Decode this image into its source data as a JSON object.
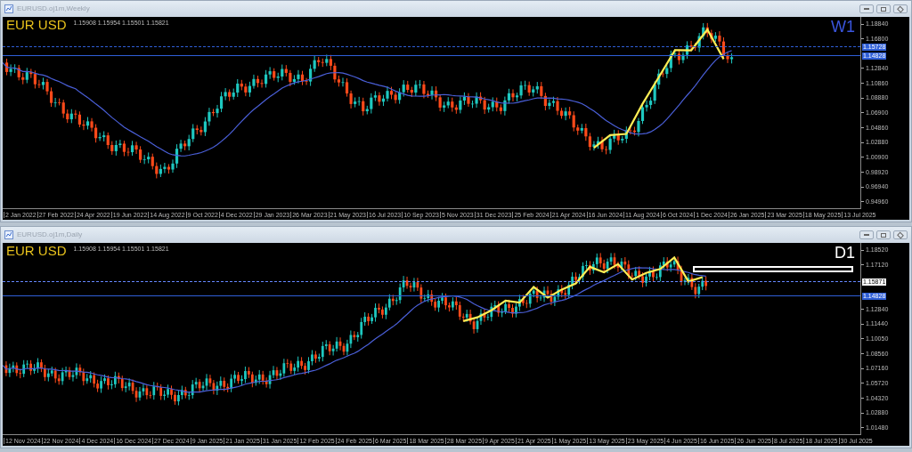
{
  "windows": [
    {
      "title": "EURUSD.oj1m,Weekly",
      "symbol": "EUR USD",
      "ohlc": "1.15908 1.15954 1.15501 1.15821",
      "timeframe": "W1",
      "price_axis": [
        "1.18840",
        "1.16800",
        "1.12840",
        "1.10860",
        "1.08880",
        "1.06900",
        "1.04860",
        "1.02880",
        "1.00900",
        "0.98920",
        "0.96940",
        "0.94960"
      ],
      "price_tags": [
        {
          "text": "1.15728",
          "color": "#2f5fd8"
        },
        {
          "text": "1.14828",
          "color": "#2f5fd8"
        }
      ],
      "time_axis": [
        "2 Jan 2022",
        "27 Feb 2022",
        "24 Apr 2022",
        "19 Jun 2022",
        "14 Aug 2022",
        "9 Oct 2022",
        "4 Dec 2022",
        "29 Jan 2023",
        "26 Mar 2023",
        "21 May 2023",
        "16 Jul 2023",
        "10 Sep 2023",
        "5 Nov 2023",
        "31 Dec 2023",
        "25 Feb 2024",
        "21 Apr 2024",
        "16 Jun 2024",
        "11 Aug 2024",
        "6 Oct 2024",
        "1 Dec 2024",
        "26 Jan 2025",
        "23 Mar 2025",
        "18 May 2025",
        "13 Jul 2025"
      ]
    },
    {
      "title": "EURUSD.oj1m,Daily",
      "symbol": "EUR USD",
      "ohlc": "1.15908 1.15954 1.15501 1.15821",
      "timeframe": "D1",
      "price_axis": [
        "1.18520",
        "1.17120",
        "1.12840",
        "1.11440",
        "1.10050",
        "1.08560",
        "1.07160",
        "1.05720",
        "1.04320",
        "1.02880",
        "1.01480"
      ],
      "price_tags": [
        {
          "text": "1.15871",
          "color": "#ffffff"
        },
        {
          "text": "1.14828",
          "color": "#2f5fd8"
        }
      ],
      "time_axis": [
        "12 Nov 2024",
        "22 Nov 2024",
        "4 Dec 2024",
        "16 Dec 2024",
        "27 Dec 2024",
        "9 Jan 2025",
        "21 Jan 2025",
        "31 Jan 2025",
        "12 Feb 2025",
        "24 Feb 2025",
        "6 Mar 2025",
        "18 Mar 2025",
        "28 Mar 2025",
        "9 Apr 2025",
        "21 Apr 2025",
        "1 May 2025",
        "13 May 2025",
        "23 May 2025",
        "4 Jun 2025",
        "16 Jun 2025",
        "26 Jun 2025",
        "8 Jul 2025",
        "18 Jul 2025",
        "30 Jul 2025"
      ],
      "objects": [
        {
          "kind": "rectangle"
        }
      ]
    }
  ]
}
